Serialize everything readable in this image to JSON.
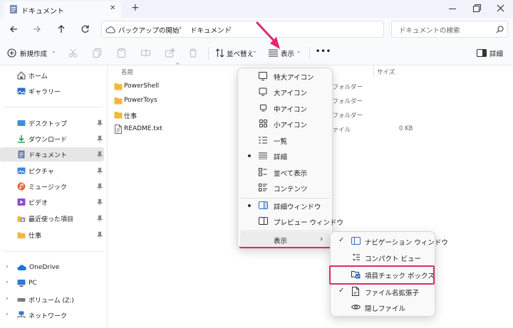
{
  "titlebar": {
    "tab_title": "ドキュメント",
    "new_tab": "+",
    "close_tab": "✕"
  },
  "nav": {
    "breadcrumb": [
      "バックアップの開始",
      "ドキュメント"
    ],
    "search_placeholder": "ドキュメントの検索"
  },
  "cmdbar": {
    "new_label": "新規作成",
    "sort_label": "並べ替え",
    "view_label": "表示",
    "more_label": "•••",
    "details_label": "詳細"
  },
  "sidebar": {
    "top": [
      {
        "label": "ホーム",
        "icon": "home-icon"
      },
      {
        "label": "ギャラリー",
        "icon": "gallery-icon"
      }
    ],
    "quick": [
      {
        "label": "デスクトップ",
        "icon": "desktop-icon",
        "color": "#3a8fd8"
      },
      {
        "label": "ダウンロード",
        "icon": "download-icon",
        "color": "#2e9d58"
      },
      {
        "label": "ドキュメント",
        "icon": "document-icon",
        "color": "#6c7da3"
      },
      {
        "label": "ピクチャ",
        "icon": "pictures-icon",
        "color": "#3b86d6"
      },
      {
        "label": "ミュージック",
        "icon": "music-icon",
        "color": "#e06b3a"
      },
      {
        "label": "ビデオ",
        "icon": "video-icon",
        "color": "#8a4bd6"
      },
      {
        "label": "最近使った項目",
        "icon": "recent-icon",
        "color": "#f1b93a"
      },
      {
        "label": "仕事",
        "icon": "folder-icon",
        "color": "#f1b93a"
      }
    ],
    "tree": [
      {
        "label": "OneDrive",
        "icon": "onedrive-icon"
      },
      {
        "label": "PC",
        "icon": "pc-icon"
      },
      {
        "label": "ボリューム (Z:)",
        "icon": "drive-icon"
      },
      {
        "label": "ネットワーク",
        "icon": "network-icon"
      }
    ]
  },
  "filelist": {
    "columns": {
      "name": "名前",
      "size": "サイズ"
    },
    "rows": [
      {
        "name": "PowerShell",
        "type": "ルフォルダー",
        "size": "",
        "icon": "folder-icon"
      },
      {
        "name": "PowerToys",
        "type": "ルフォルダー",
        "size": "",
        "icon": "folder-icon"
      },
      {
        "name": "仕事",
        "type": "ルフォルダー",
        "size": "",
        "icon": "folder-icon"
      },
      {
        "name": "README.txt",
        "type": "ファイル",
        "size": "0 KB",
        "icon": "text-file-icon"
      }
    ]
  },
  "view_menu": {
    "items": [
      {
        "label": "特大アイコン",
        "icon": "extra-large-icons-icon"
      },
      {
        "label": "大アイコン",
        "icon": "large-icons-icon"
      },
      {
        "label": "中アイコン",
        "icon": "medium-icons-icon"
      },
      {
        "label": "小アイコン",
        "icon": "small-icons-icon"
      },
      {
        "label": "一覧",
        "icon": "list-icon"
      },
      {
        "label": "詳細",
        "icon": "details-icon",
        "selected": true
      },
      {
        "label": "並べて表示",
        "icon": "tiles-icon"
      },
      {
        "label": "コンテンツ",
        "icon": "content-icon"
      },
      {
        "label": "詳細ウィンドウ",
        "icon": "details-pane-icon",
        "selected": true
      },
      {
        "label": "プレビュー ウィンドウ",
        "icon": "preview-pane-icon"
      }
    ],
    "show_label": "表示"
  },
  "show_submenu": {
    "items": [
      {
        "label": "ナビゲーション ウィンドウ",
        "icon": "navigation-pane-icon",
        "checked": true
      },
      {
        "label": "コンパクト ビュー",
        "icon": "compact-view-icon",
        "checked": false
      },
      {
        "label": "項目チェック ボックス",
        "icon": "item-checkbox-icon",
        "checked": false
      },
      {
        "label": "ファイル名拡張子",
        "icon": "file-extension-icon",
        "checked": true
      },
      {
        "label": "隠しファイル",
        "icon": "hidden-files-icon",
        "checked": false
      }
    ]
  },
  "colors": {
    "accent": "#e0286f",
    "folder": "#f1b93a"
  }
}
